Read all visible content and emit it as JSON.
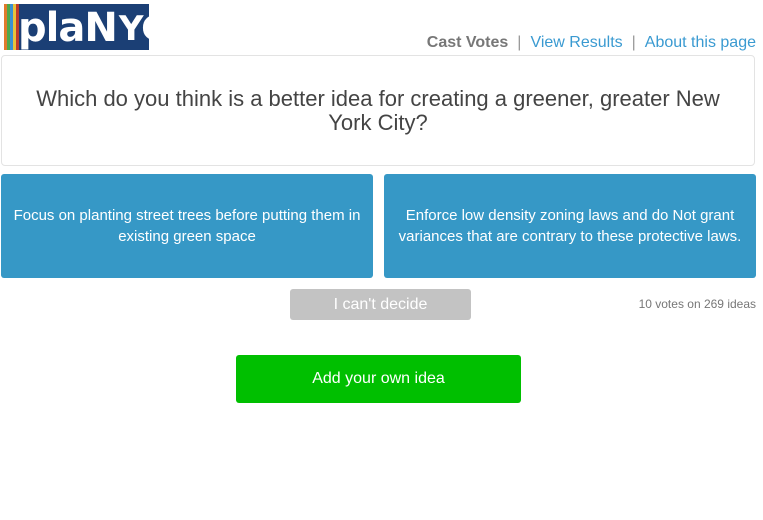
{
  "logo": {
    "text_plan": "plaN",
    "text_nyc": "YC",
    "colors": [
      "#e07a2c",
      "#4fa84a",
      "#3b8fd1",
      "#e8c13b",
      "#c0392b"
    ]
  },
  "nav": {
    "cast_votes": "Cast Votes",
    "separator": "|",
    "view_results": "View Results",
    "about": "About this page"
  },
  "question": "Which do you think is a better idea for creating a greener, greater New York City?",
  "choices": [
    {
      "label": "Focus on planting street trees before putting them in existing green space"
    },
    {
      "label": "Enforce low density zoning laws and do Not grant variances that are contrary to these protective laws."
    }
  ],
  "cant_decide": "I can't decide",
  "vote_count": "10 votes on 269 ideas",
  "add_idea": "Add your own idea",
  "colors": {
    "choice_bg": "#3698c6",
    "add_idea_bg": "#00bf00",
    "cant_decide_bg": "#c3c3c3",
    "link": "#3a9ad1"
  }
}
